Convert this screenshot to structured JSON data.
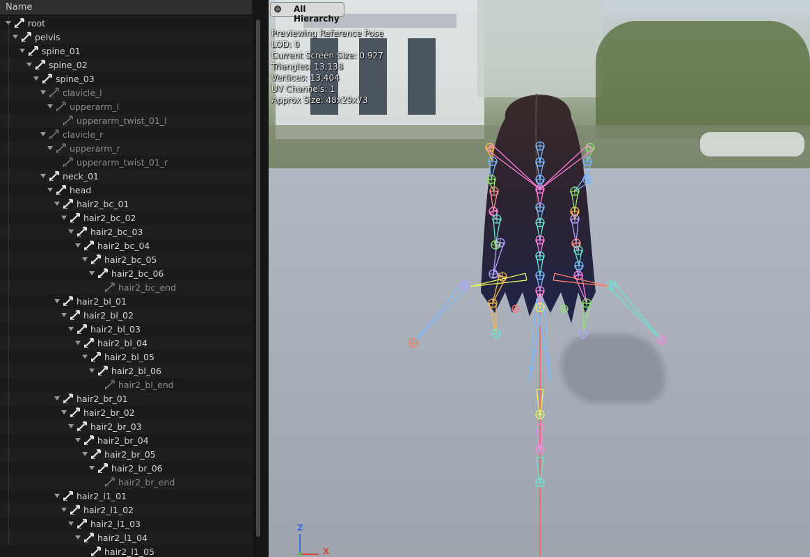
{
  "tree": {
    "header": "Name",
    "rows": [
      {
        "label": "root",
        "depth": 0,
        "dim": false
      },
      {
        "label": "pelvis",
        "depth": 1,
        "dim": false
      },
      {
        "label": "spine_01",
        "depth": 2,
        "dim": false
      },
      {
        "label": "spine_02",
        "depth": 3,
        "dim": false
      },
      {
        "label": "spine_03",
        "depth": 4,
        "dim": false
      },
      {
        "label": "clavicle_l",
        "depth": 5,
        "dim": true
      },
      {
        "label": "upperarm_l",
        "depth": 6,
        "dim": true
      },
      {
        "label": "upperarm_twist_01_l",
        "depth": 7,
        "dim": true
      },
      {
        "label": "clavicle_r",
        "depth": 5,
        "dim": true
      },
      {
        "label": "upperarm_r",
        "depth": 6,
        "dim": true
      },
      {
        "label": "upperarm_twist_01_r",
        "depth": 7,
        "dim": true
      },
      {
        "label": "neck_01",
        "depth": 5,
        "dim": false
      },
      {
        "label": "head",
        "depth": 6,
        "dim": false
      },
      {
        "label": "hair2_bc_01",
        "depth": 7,
        "dim": false
      },
      {
        "label": "hair2_bc_02",
        "depth": 8,
        "dim": false
      },
      {
        "label": "hair2_bc_03",
        "depth": 9,
        "dim": false
      },
      {
        "label": "hair2_bc_04",
        "depth": 10,
        "dim": false
      },
      {
        "label": "hair2_bc_05",
        "depth": 11,
        "dim": false
      },
      {
        "label": "hair2_bc_06",
        "depth": 12,
        "dim": false
      },
      {
        "label": "hair2_bc_end",
        "depth": 13,
        "dim": true
      },
      {
        "label": "hair2_bl_01",
        "depth": 7,
        "dim": false
      },
      {
        "label": "hair2_bl_02",
        "depth": 8,
        "dim": false
      },
      {
        "label": "hair2_bl_03",
        "depth": 9,
        "dim": false
      },
      {
        "label": "hair2_bl_04",
        "depth": 10,
        "dim": false
      },
      {
        "label": "hair2_bl_05",
        "depth": 11,
        "dim": false
      },
      {
        "label": "hair2_bl_06",
        "depth": 12,
        "dim": false
      },
      {
        "label": "hair2_bl_end",
        "depth": 13,
        "dim": true
      },
      {
        "label": "hair2_br_01",
        "depth": 7,
        "dim": false
      },
      {
        "label": "hair2_br_02",
        "depth": 8,
        "dim": false
      },
      {
        "label": "hair2_br_03",
        "depth": 9,
        "dim": false
      },
      {
        "label": "hair2_br_04",
        "depth": 10,
        "dim": false
      },
      {
        "label": "hair2_br_05",
        "depth": 11,
        "dim": false
      },
      {
        "label": "hair2_br_06",
        "depth": 12,
        "dim": false
      },
      {
        "label": "hair2_br_end",
        "depth": 13,
        "dim": true
      },
      {
        "label": "hair2_l1_01",
        "depth": 7,
        "dim": false
      },
      {
        "label": "hair2_l1_02",
        "depth": 8,
        "dim": false
      },
      {
        "label": "hair2_l1_03",
        "depth": 9,
        "dim": false
      },
      {
        "label": "hair2_l1_04",
        "depth": 10,
        "dim": false
      },
      {
        "label": "hair2_l1_05",
        "depth": 11,
        "dim": false
      }
    ]
  },
  "viewport": {
    "hierarchy_button": "All Hierarchy",
    "stats": [
      "Previewing Reference Pose",
      "LOD: 0",
      "Current Screen Size: 0.927",
      "Triangles: 13,138",
      "Vertices: 13,404",
      "UV Channels: 1",
      "Approx Size: 48x29x73"
    ],
    "axis": {
      "z": "Z",
      "x": "X"
    },
    "colors": {
      "bone_palette": [
        "#f7b64a",
        "#8fe36d",
        "#78b8ff",
        "#ff7fe0",
        "#67e6d8",
        "#e7f25c",
        "#b6a4ff",
        "#ff8f8f"
      ]
    }
  }
}
